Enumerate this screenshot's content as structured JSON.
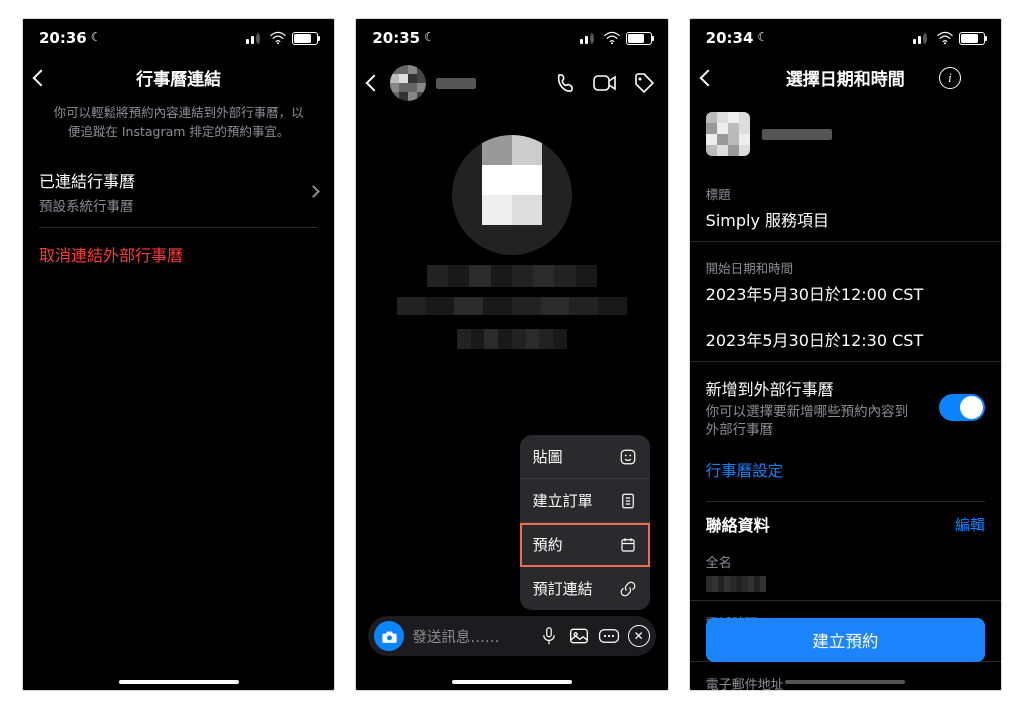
{
  "screen1": {
    "time": "20:36",
    "title": "行事曆連結",
    "caption": "你可以輕鬆將預約內容連結到外部行事曆，以便追蹤在 Instagram 排定的預約事宜。",
    "linked_label": "已連結行事曆",
    "linked_sub": "預設系統行事曆",
    "unlink": "取消連結外部行事曆"
  },
  "screen2": {
    "time": "20:35",
    "composer_placeholder": "發送訊息……",
    "menu": {
      "sticker": "貼圖",
      "create_order": "建立訂單",
      "booking": "預約",
      "booking_link": "預訂連結"
    }
  },
  "screen3": {
    "time": "20:34",
    "title": "選擇日期和時間",
    "title_label": "標題",
    "title_value": "Simply 服務項目",
    "start_label": "開始日期和時間",
    "start_value": "2023年5月30日於12:00 CST",
    "end_value": "2023年5月30日於12:30 CST",
    "addcal_label": "新增到外部行事曆",
    "addcal_sub": "你可以選擇要新增哪些預約內容到外部行事曆",
    "cal_settings": "行事曆設定",
    "contact_title": "聯絡資料",
    "edit": "編輯",
    "fullname_label": "全名",
    "phone_label": "電話號碼",
    "email_label": "電子郵件地址",
    "cta": "建立預約"
  }
}
